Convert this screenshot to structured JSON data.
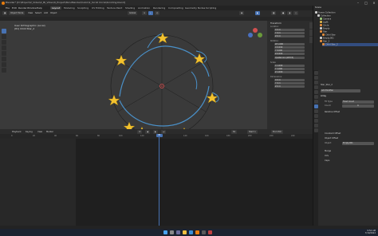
{
  "window": {
    "title": "Blender* [D:\\Project\\2_Video\\2_Bl_Video\\9_Project\\Non-Blender\\Cubic\\2_Scroll Circle\\Scrolling.blend]"
  },
  "menu": {
    "items": [
      "File",
      "Edit",
      "Render",
      "Window",
      "Help"
    ]
  },
  "workspaces": {
    "tabs": [
      "Layout",
      "Modeling",
      "Sculpting",
      "UV Editing",
      "Texture Paint",
      "Shading",
      "Animation",
      "Rendering",
      "Compositing",
      "Geometry Nodes",
      "Scripting"
    ],
    "active_index": 0
  },
  "viewport_header": {
    "mode": "Object Mode",
    "view": "View",
    "select": "Select",
    "add": "Add",
    "object": "Object",
    "orientation": "Global"
  },
  "viewport": {
    "view_name": "User Orthographic (Local)",
    "object_info": "(81) Child Star_2",
    "colors": {
      "background": "#3a3a3a",
      "circle": "#4a90c8",
      "star": "#f2c12e"
    }
  },
  "npanel": {
    "section": "Transform",
    "location_label": "Location:",
    "rotation_label": "Rotation:",
    "mode_label": "Quaternion (WXYZ)",
    "scale_label": "Scale:",
    "dimensions_label": "Dimensions:",
    "location": [
      "X  0 m",
      "Y  0 m",
      "Z  0 m"
    ],
    "rotation": [
      "W  1.000",
      "X  0.000",
      "Y  0.000",
      "Z  0.000"
    ],
    "scale": [
      "X  1.000",
      "Y  1.000",
      "Z  1.000"
    ],
    "dimensions": [
      "X  0 m",
      "Y  0 m",
      "Z  0 m"
    ],
    "tabs": [
      "Item",
      "Tool",
      "View"
    ]
  },
  "outliner": {
    "header": "Scene",
    "rows": [
      {
        "label": "Scene Collection",
        "color": "#cccccc"
      },
      {
        "label": "Collection",
        "color": "#cccccc"
      },
      {
        "label": "Camera",
        "color": "#9ec97a"
      },
      {
        "label": "Light",
        "color": "#d9b34a"
      },
      {
        "label": "Circle",
        "color": "#e08a3a"
      },
      {
        "label": "Empty",
        "color": "#cccccc"
      },
      {
        "label": "Star",
        "color": "#e08a3a"
      },
      {
        "label": "Child Star",
        "color": "#e08a3a"
      },
      {
        "label": "Empty.001",
        "color": "#cccccc"
      },
      {
        "label": "Star_2",
        "color": "#e08a3a"
      },
      {
        "label": "Child Star_2",
        "color": "#e08a3a"
      }
    ]
  },
  "properties": {
    "object_name": "Star_Star_2",
    "modifier_label": "Add Modifier",
    "modifier_name": "Array",
    "fit_type_label": "Fit Type",
    "fit_type": "Fixed Count",
    "count_label": "Count",
    "count": "6",
    "relative_offset": "Relative Offset",
    "constant_offset": "Constant Offset",
    "object_offset": "Object Offset",
    "object_label": "Object",
    "object_value": "Empty.001",
    "merge": "Merge",
    "uvs": "UVs",
    "caps": "Caps"
  },
  "timeline": {
    "menu": [
      "Playback",
      "Keying",
      "View",
      "Marker"
    ],
    "current_frame": "81",
    "start": "Start 1",
    "end": "End 250",
    "ticks": [
      "0",
      "20",
      "40",
      "60",
      "80",
      "100",
      "120",
      "140",
      "160",
      "180",
      "200",
      "220",
      "240"
    ]
  },
  "taskbar": {
    "time": "9:54 AM",
    "date": "7/10/2022"
  }
}
